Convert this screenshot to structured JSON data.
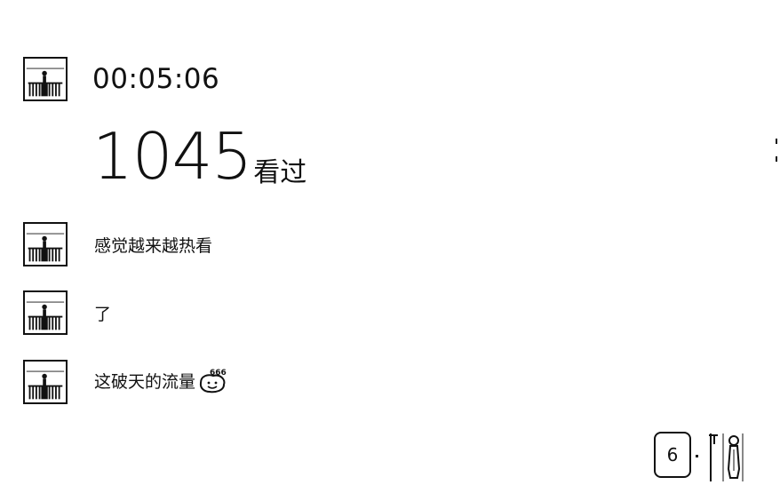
{
  "stream": {
    "elapsed_time": "00:05:06",
    "viewer_count": "1045",
    "viewer_label": "看过"
  },
  "comments": [
    {
      "text": "感觉越来越热看",
      "avatar_icon": "user-avatar-icon"
    },
    {
      "text": "了",
      "avatar_icon": "user-avatar-icon"
    },
    {
      "text": "这破天的流量",
      "avatar_icon": "user-avatar-icon",
      "emoji_icon": "666-emoji-icon",
      "emoji_text": "666"
    }
  ],
  "bottom_bar": {
    "badge_value": "6"
  }
}
